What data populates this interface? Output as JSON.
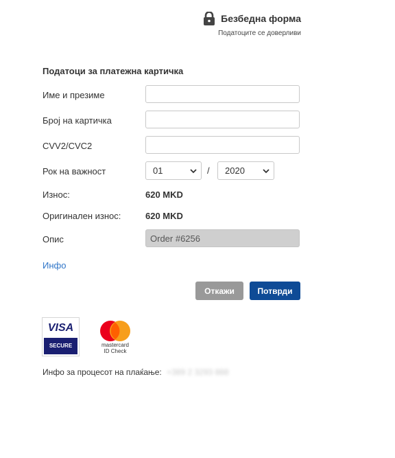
{
  "header": {
    "secure_title": "Безбедна форма",
    "secure_subtitle": "Податоците се доверливи",
    "icon": "lock-icon"
  },
  "form": {
    "section_title": "Податоци за платежна картичка",
    "name_label": "Име и презиме",
    "name_value": "",
    "card_label": "Број на картичка",
    "card_value": "",
    "cvv_label": "CVV2/CVC2",
    "cvv_value": "",
    "expiry_label": "Рок на важност",
    "expiry_month": "01",
    "expiry_separator": "/",
    "expiry_year": "2020",
    "amount_label": "Износ:",
    "amount_value": "620 MKD",
    "original_amount_label": "Оригинален износ:",
    "original_amount_value": "620 MKD",
    "description_label": "Опис",
    "description_value": "Order #6256",
    "info_link": "Инфо"
  },
  "actions": {
    "cancel_label": "Откажи",
    "confirm_label": "Потврди",
    "cancel_color": "#999999",
    "confirm_color": "#0f4b96"
  },
  "badges": {
    "visa_word": "VISA",
    "visa_secure": "SECURE",
    "mc_line1": "mastercard",
    "mc_line2": "ID Check"
  },
  "footer": {
    "process_label": "Инфо за процесот на плаќање:",
    "process_phone": "+389 2 3293 888"
  }
}
